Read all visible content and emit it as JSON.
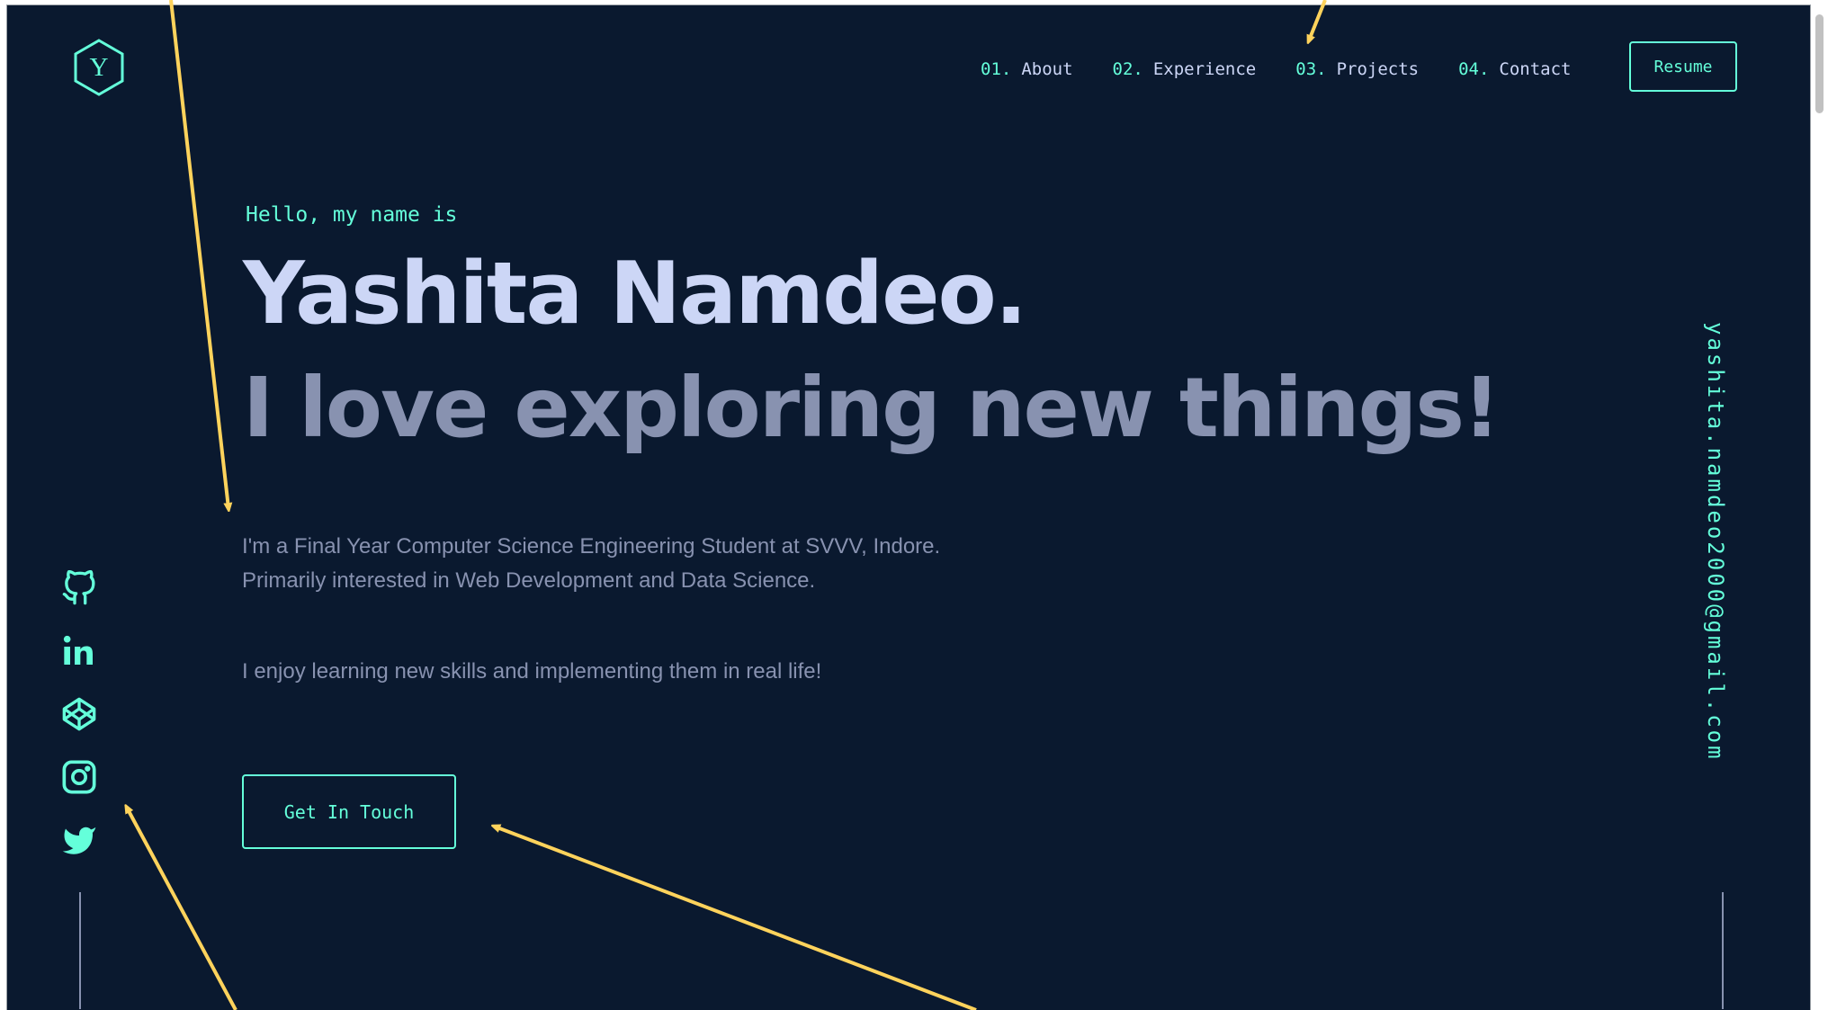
{
  "header": {
    "logo_letter": "Y",
    "nav": [
      {
        "num": "01.",
        "label": "About"
      },
      {
        "num": "02.",
        "label": "Experience"
      },
      {
        "num": "03.",
        "label": "Projects"
      },
      {
        "num": "04.",
        "label": "Contact"
      }
    ],
    "resume_label": "Resume"
  },
  "hero": {
    "intro": "Hello, my name is",
    "name": "Yashita Namdeo.",
    "tagline": "I love exploring new things!",
    "paragraph1": "I'm a Final Year Computer Science Engineering Student at SVVV, Indore. Primarily interested in Web Development and Data Science.",
    "paragraph2": "I enjoy learning new skills and implementing them in real life!",
    "cta_label": "Get In Touch"
  },
  "socials": [
    "github-icon",
    "linkedin-icon",
    "codepen-icon",
    "instagram-icon",
    "twitter-icon"
  ],
  "email": "yashita.namdeo2000@gmail.com",
  "colors": {
    "background": "#0a192f",
    "accent": "#64ffda",
    "heading": "#ccd6f6",
    "muted": "#8892b0",
    "annotation_arrow": "#ffd35c"
  }
}
